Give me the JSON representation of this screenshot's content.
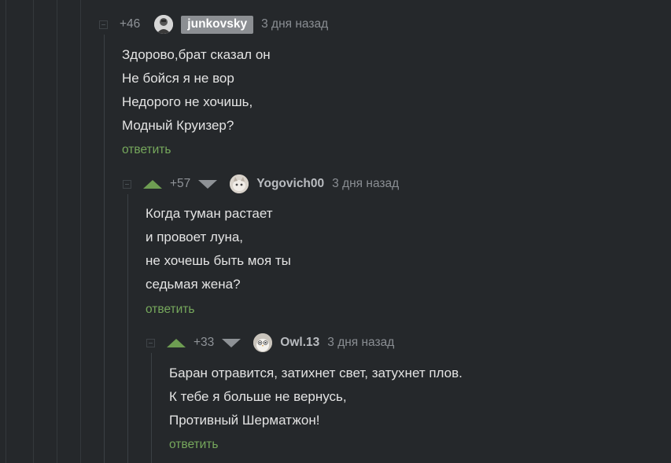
{
  "comments": [
    {
      "rating": "+46",
      "author": "junkovsky",
      "time": "3 дня назад",
      "lines": [
        "Здорово,брат сказал он",
        "Не бойся я не вор",
        "Недорого не хочишь,",
        "Модный Круизер?"
      ],
      "reply_label": "ответить",
      "avatar_icon": "man-portrait-icon"
    },
    {
      "rating": "+57",
      "author": "Yogovich00",
      "time": "3 дня назад",
      "lines": [
        "Когда туман растает",
        "и провоет луна,",
        "не хочешь быть моя ты",
        "седьмая жена?"
      ],
      "reply_label": "ответить",
      "avatar_icon": "cat-portrait-icon"
    },
    {
      "rating": "+33",
      "author": "Owl.13",
      "time": "3 дня назад",
      "lines": [
        "Баран отравится, затихнет свет, затухнет плов.",
        "К тебе я больше не вернусь,",
        "Противный Шерматжон!"
      ],
      "reply_label": "ответить",
      "avatar_icon": "owl-icon"
    }
  ],
  "colors": {
    "background": "#25282b",
    "upvote": "#6e9d52",
    "reply_link": "#76a85c",
    "badge": "#8c8f93"
  }
}
